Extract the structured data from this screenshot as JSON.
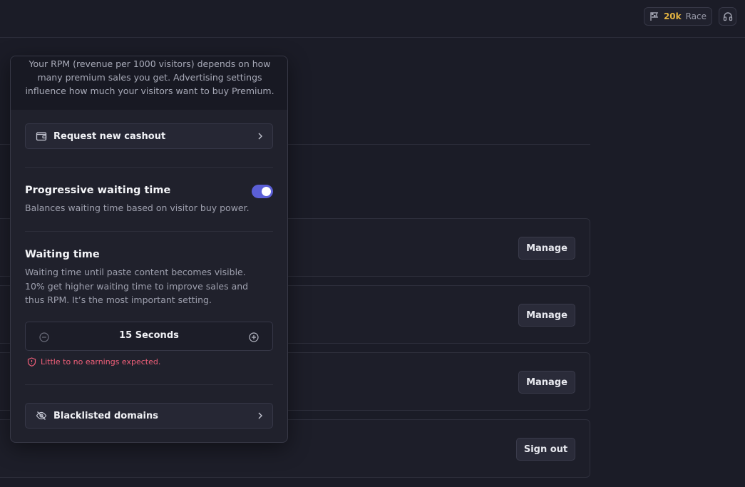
{
  "topbar": {
    "race_amount": "20k",
    "race_label": "Race"
  },
  "background": {
    "manage_label": "Manage",
    "signout_label": "Sign out"
  },
  "popover": {
    "intro": "Your RPM (revenue per 1000 visitors) depends on how many premium sales you get. Advertising settings influence how much your visitors want to buy Premium.",
    "cashout_label": "Request new cashout",
    "progressive": {
      "title": "Progressive waiting time",
      "description": "Balances waiting time based on visitor buy power.",
      "enabled": true
    },
    "waiting": {
      "title": "Waiting time",
      "description": "Waiting time until paste content becomes visible. 10% get higher waiting time to improve sales and thus RPM. It’s the most important setting.",
      "value": "15 Seconds",
      "warning": "Little to no earnings expected."
    },
    "blacklist_label": "Blacklisted domains"
  },
  "colors": {
    "accent": "#5b5fd6",
    "warning": "#f2607a",
    "race_gold": "#e3b341"
  }
}
